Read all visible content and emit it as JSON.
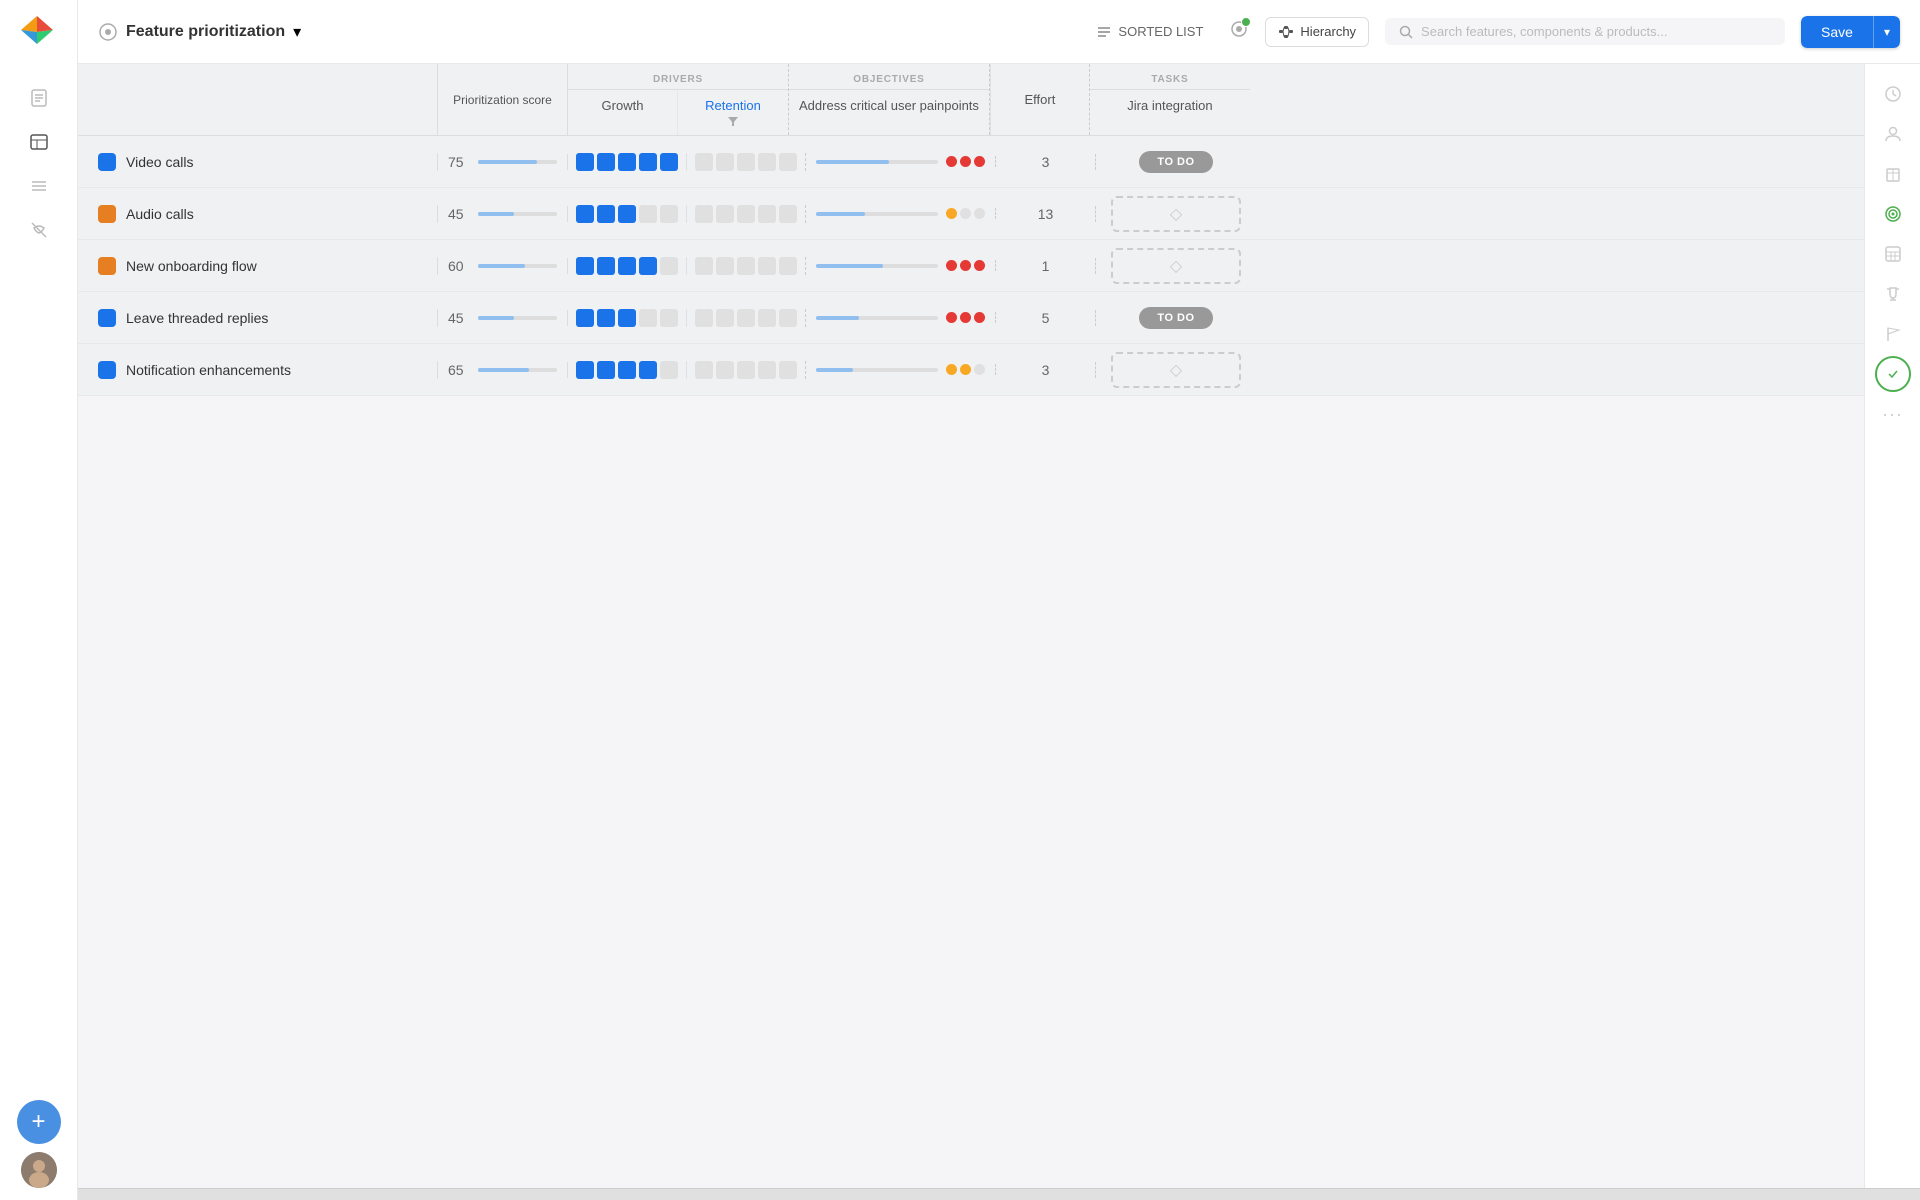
{
  "app": {
    "title": "Feature prioritization",
    "logo_alt": "App logo"
  },
  "topnav": {
    "sorted_list_label": "SORTED LIST",
    "hierarchy_label": "Hierarchy",
    "search_placeholder": "Search features, components & products...",
    "save_label": "Save"
  },
  "left_sidebar": {
    "icons": [
      "document",
      "list",
      "lines",
      "eye-off"
    ]
  },
  "table": {
    "sections": [
      {
        "name": "drivers_label",
        "label": "DRIVERS",
        "cols": [
          {
            "id": "growth",
            "label": "Growth",
            "active": false
          },
          {
            "id": "retention",
            "label": "Retention",
            "active": true
          }
        ]
      },
      {
        "name": "objectives_label",
        "label": "OBJECTIVES",
        "cols": [
          {
            "id": "address",
            "label": "Address critical user painpoints",
            "active": false
          }
        ]
      },
      {
        "name": "tasks_label",
        "label": "TASKS",
        "cols": [
          {
            "id": "jira",
            "label": "Jira integration",
            "active": false
          }
        ]
      }
    ],
    "score_col_label": "Prioritization score",
    "effort_col_label": "Effort",
    "features": [
      {
        "name": "Video calls",
        "color": "#1a73e8",
        "score": 75,
        "score_pct": 75,
        "growth_filled": 5,
        "growth_total": 5,
        "retention_filled": 0,
        "retention_total": 5,
        "obj_bar_pct": 60,
        "obj_dots": [
          "red",
          "red",
          "red"
        ],
        "effort": 3,
        "task": "todo"
      },
      {
        "name": "Audio calls",
        "color": "#e67e22",
        "score": 45,
        "score_pct": 45,
        "growth_filled": 3,
        "growth_total": 5,
        "retention_filled": 0,
        "retention_total": 5,
        "obj_bar_pct": 40,
        "obj_dots": [
          "yellow",
          "empty",
          "empty"
        ],
        "effort": 13,
        "task": "diamond"
      },
      {
        "name": "New onboarding flow",
        "color": "#e67e22",
        "score": 60,
        "score_pct": 60,
        "growth_filled": 4,
        "growth_total": 5,
        "retention_filled": 0,
        "retention_total": 5,
        "obj_bar_pct": 55,
        "obj_dots": [
          "red",
          "red",
          "red"
        ],
        "effort": 1,
        "task": "diamond"
      },
      {
        "name": "Leave threaded replies",
        "color": "#1a73e8",
        "score": 45,
        "score_pct": 45,
        "growth_filled": 3,
        "growth_total": 5,
        "retention_filled": 0,
        "retention_total": 5,
        "obj_bar_pct": 35,
        "obj_dots": [
          "red",
          "red",
          "red"
        ],
        "effort": 5,
        "task": "todo"
      },
      {
        "name": "Notification enhancements",
        "color": "#1a73e8",
        "score": 65,
        "score_pct": 65,
        "growth_filled": 4,
        "growth_total": 5,
        "retention_filled": 0,
        "retention_total": 5,
        "obj_bar_pct": 30,
        "obj_dots": [
          "yellow",
          "yellow",
          "empty"
        ],
        "effort": 3,
        "task": "diamond"
      }
    ]
  },
  "right_sidebar": {
    "icons": [
      "clock",
      "person",
      "building",
      "target",
      "table",
      "trophy",
      "flag",
      "check-circle",
      "more"
    ]
  }
}
